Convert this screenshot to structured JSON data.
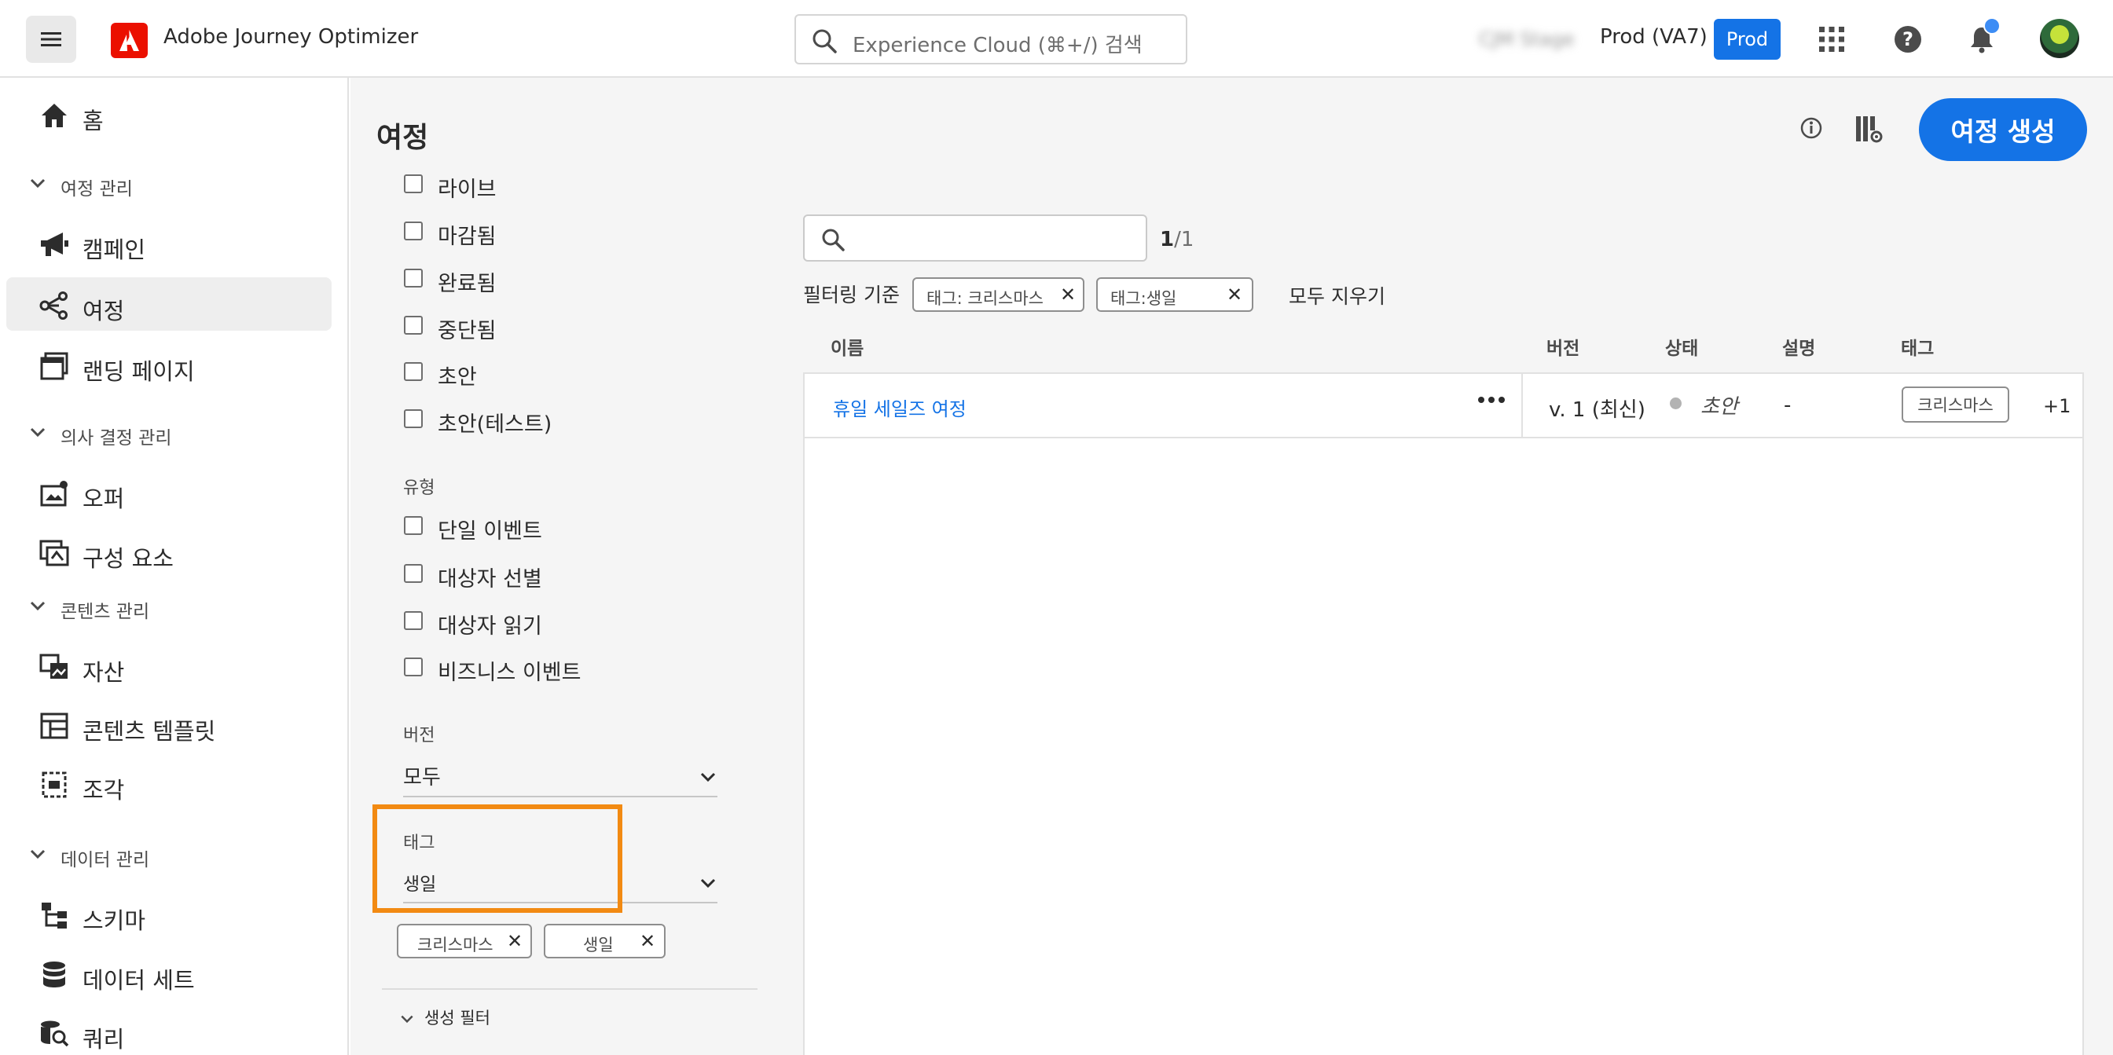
{
  "header": {
    "app_name": "Adobe Journey Optimizer",
    "search_placeholder": "Experience Cloud (⌘+/) 검색",
    "org_name": "CJM Stage",
    "env_label": "Prod (VA7)",
    "env_badge": "Prod"
  },
  "sidebar": {
    "home": "홈",
    "sections": [
      {
        "label": "여정 관리",
        "items": [
          "캠페인",
          "여정",
          "랜딩 페이지"
        ]
      },
      {
        "label": "의사 결정 관리",
        "items": [
          "오퍼",
          "구성 요소"
        ]
      },
      {
        "label": "콘텐츠 관리",
        "items": [
          "자산",
          "콘텐츠 템플릿",
          "조각"
        ]
      },
      {
        "label": "데이터 관리",
        "items": [
          "스키마",
          "데이터 세트",
          "쿼리"
        ]
      }
    ],
    "active_item": "여정"
  },
  "page": {
    "title": "여정",
    "create_button": "여정 생성"
  },
  "filters": {
    "status_options": [
      "라이브",
      "마감됨",
      "완료됨",
      "중단됨",
      "초안",
      "초안(테스트)"
    ],
    "type_label": "유형",
    "type_options": [
      "단일 이벤트",
      "대상자 선별",
      "대상자 읽기",
      "비즈니스 이벤트"
    ],
    "version_label": "버전",
    "version_value": "모두",
    "tag_label": "태그",
    "tag_value": "생일",
    "selected_tags": [
      "크리스마스",
      "생일"
    ],
    "creation_filter": "생성 필터"
  },
  "results": {
    "count_current": "1",
    "count_total": "/1",
    "filter_by_label": "필터링 기준",
    "active_filters": [
      "태그: 크리스마스",
      "태그:생일"
    ],
    "clear_all": "모두 지우기",
    "columns": [
      "이름",
      "버전",
      "상태",
      "설명",
      "태그"
    ],
    "rows": [
      {
        "name": "휴일 세일즈 여정",
        "version": "v. 1 (최신)",
        "status": "초안",
        "description": "-",
        "tag": "크리스마스",
        "more_tags": "+1"
      }
    ]
  },
  "colors": {
    "accent": "#1473e6",
    "highlight": "#f28a12",
    "adobe_red": "#eb1000"
  }
}
